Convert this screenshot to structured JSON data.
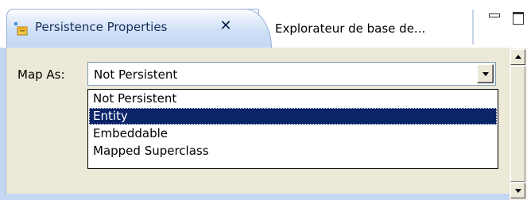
{
  "tabs": [
    {
      "label": "Persistence Properties",
      "active": true,
      "icon": "persistence-properties-icon",
      "close_glyph": "✕"
    },
    {
      "label": "Explorateur de base de...",
      "active": false
    }
  ],
  "window_controls": {
    "minimize_icon": "minimize-icon",
    "maximize_icon": "maximize-icon"
  },
  "form": {
    "map_as_label": "Map As:",
    "map_as_value": "Not Persistent",
    "options": [
      "Not Persistent",
      "Entity",
      "Embeddable",
      "Mapped Superclass"
    ],
    "highlighted_option": "Entity"
  },
  "colors": {
    "selection": "#0a246a",
    "tab_gradient": "#c4d8f3",
    "panel_bg": "#ece9d8"
  }
}
